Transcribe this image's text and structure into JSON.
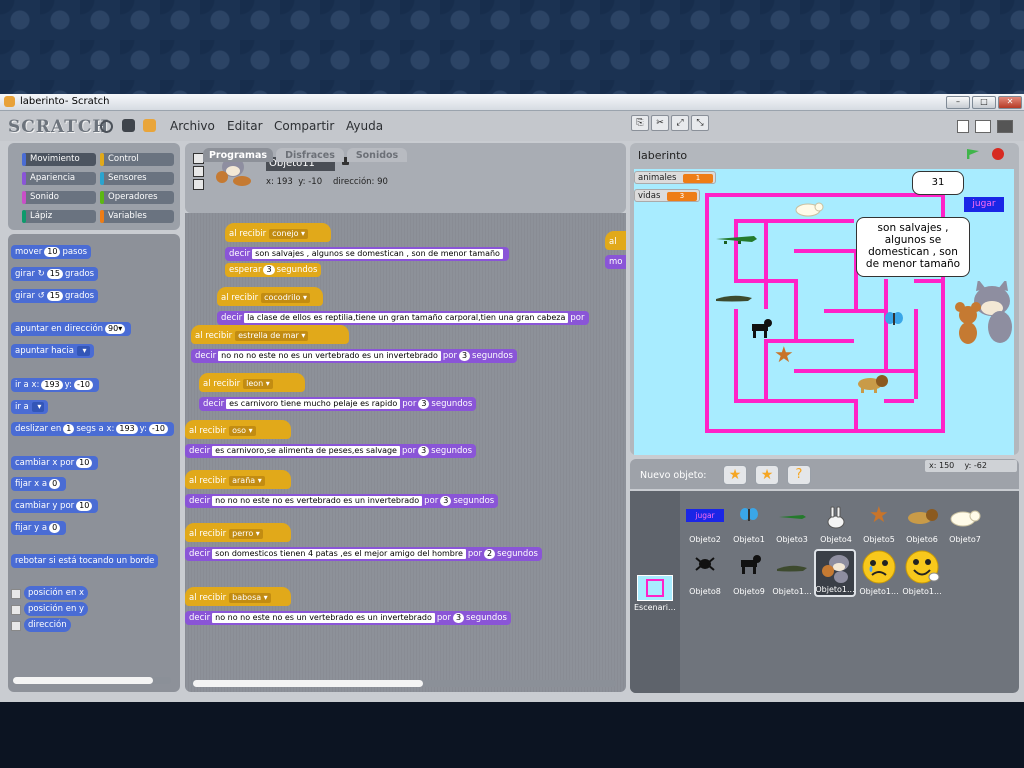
{
  "window": {
    "title": "laberinto- Scratch",
    "controls": {
      "minimize": "–",
      "maximize": "□",
      "close": "✕"
    }
  },
  "menubar": {
    "logo": "SCRATCH",
    "icons": [
      "globe-icon",
      "save-icon",
      "share-icon"
    ],
    "menus": [
      "Archivo",
      "Editar",
      "Compartir",
      "Ayuda"
    ],
    "edit_modes": [
      "stamp-icon",
      "scissors-icon",
      "grow-icon",
      "shrink-icon"
    ]
  },
  "categories": [
    {
      "label": "Movimiento",
      "color": "#4a6cd4",
      "selected": true
    },
    {
      "label": "Control",
      "color": "#e1a91a",
      "selected": false
    },
    {
      "label": "Apariencia",
      "color": "#8a55d7",
      "selected": false
    },
    {
      "label": "Sensores",
      "color": "#2aa4cf",
      "selected": false
    },
    {
      "label": "Sonido",
      "color": "#c94fc7",
      "selected": false
    },
    {
      "label": "Operadores",
      "color": "#5cb712",
      "selected": false
    },
    {
      "label": "Lápiz",
      "color": "#0e9a6c",
      "selected": false
    },
    {
      "label": "Variables",
      "color": "#ee7d16",
      "selected": false
    }
  ],
  "palette": {
    "mover": {
      "pre": "mover",
      "val": "10",
      "post": "pasos"
    },
    "girar_r": {
      "pre": "girar",
      "icon": "↻",
      "val": "15",
      "post": "grados"
    },
    "girar_l": {
      "pre": "girar",
      "icon": "↺",
      "val": "15",
      "post": "grados"
    },
    "apuntar_dir": {
      "pre": "apuntar en dirección",
      "val": "90▾"
    },
    "apuntar_hacia": {
      "pre": "apuntar hacia"
    },
    "ir_a_xy": {
      "pre": "ir a x:",
      "x": "193",
      "mid": "y:",
      "y": "-10"
    },
    "ir_a": {
      "pre": "ir a"
    },
    "deslizar": {
      "pre": "deslizar en",
      "val": "1",
      "mid": "segs a x:",
      "x": "193",
      "mid2": "y:",
      "y": "-10"
    },
    "cambiar_x": {
      "pre": "cambiar x por",
      "val": "10"
    },
    "fijar_x": {
      "pre": "fijar x a",
      "val": "0"
    },
    "cambiar_y": {
      "pre": "cambiar y por",
      "val": "10"
    },
    "fijar_y": {
      "pre": "fijar y a",
      "val": "0"
    },
    "rebotar": {
      "label": "rebotar si está tocando un borde"
    },
    "pos_x": {
      "label": "posición en x"
    },
    "pos_y": {
      "label": "posición en y"
    },
    "direccion": {
      "label": "dirección"
    }
  },
  "sprite_info": {
    "name": "Objeto11",
    "x_label": "x:",
    "x": "193",
    "y_label": "y:",
    "y": "-10",
    "dir_label": "dirección:",
    "dir": "90"
  },
  "tabs": [
    "Programas",
    "Disfraces",
    "Sonidos"
  ],
  "scripts": [
    {
      "hat": "al recibir",
      "msg": "conejo",
      "say": "decir",
      "text": "son salvajes , algunos se domestican , son de menor tamaño",
      "extra": {
        "pre": "esperar",
        "val": "3",
        "post": "segundos"
      }
    },
    {
      "hat": "al recibir",
      "msg": "cocodrilo",
      "say": "decir",
      "text": "la clase de ellos es reptilia,tiene un gran tamaño carporal,tien una gran cabeza",
      "por": "por"
    },
    {
      "hat": "al recibir",
      "msg": "estrella de mar",
      "say": "decir",
      "text": "no no no este no es un vertebrado es un invertebrado",
      "por": "por",
      "val": "3",
      "post": "segundos"
    },
    {
      "hat": "al recibir",
      "msg": "leon",
      "say": "decir",
      "text": "es carnivoro tiene mucho pelaje es rapido",
      "por": "por",
      "val": "3",
      "post": "segundos"
    },
    {
      "hat": "al recibir",
      "msg": "oso",
      "say": "decir",
      "text": "es carnivoro,se alimenta de peses,es salvage",
      "por": "por",
      "val": "3",
      "post": "segundos"
    },
    {
      "hat": "al recibir",
      "msg": "araña",
      "say": "decir",
      "text": "no no no este no es vertebrado es un invertebrado",
      "por": "por",
      "val": "3",
      "post": "segundos"
    },
    {
      "hat": "al recibir",
      "msg": "perro",
      "say": "decir",
      "text": "son domesticos tienen 4 patas ,es el  mejor amigo del hombre",
      "por": "por",
      "val": "2",
      "post": "segundos"
    },
    {
      "hat": "al recibir",
      "msg": "babosa",
      "say": "decir",
      "text": "no no no este no es un vertebrado es un invertebrado",
      "por": "por",
      "val": "3",
      "post": "segundos"
    }
  ],
  "offscreen_script": {
    "hat": "al",
    "say": "mo"
  },
  "stage": {
    "title": "laberinto",
    "vars": [
      {
        "name": "animales",
        "value": "1"
      },
      {
        "name": "vidas",
        "value": "3"
      }
    ],
    "bubble_score": "31",
    "bubble_text": "son salvajes , algunos se domestican , son de menor tamaño",
    "jugar_label": "jugar",
    "coords": {
      "x_label": "x:",
      "x": "150",
      "y_label": "y:",
      "y": "-62"
    }
  },
  "new_sprite": {
    "label": "Nuevo objeto:"
  },
  "sprites": [
    {
      "label": "Objeto2",
      "icon": "jugar-button-sprite"
    },
    {
      "label": "Objeto1",
      "icon": "butterfly-icon"
    },
    {
      "label": "Objeto3",
      "icon": "crocodile-icon"
    },
    {
      "label": "Objeto4",
      "icon": "rabbit-icon"
    },
    {
      "label": "Objeto5",
      "icon": "starfish-icon"
    },
    {
      "label": "Objeto6",
      "icon": "lion-icon"
    },
    {
      "label": "Objeto7",
      "icon": "bear-icon"
    },
    {
      "label": "Objeto8",
      "icon": "spider-icon"
    },
    {
      "label": "Objeto9",
      "icon": "dog-icon"
    },
    {
      "label": "Objeto1...",
      "icon": "slug-icon"
    },
    {
      "label": "Objeto1...",
      "icon": "tom-jerry-icon",
      "selected": true
    },
    {
      "label": "Objeto1...",
      "icon": "sad-face-icon"
    },
    {
      "label": "Objeto1...",
      "icon": "happy-face-icon"
    }
  ],
  "stage_thumb": {
    "label": "Escenari..."
  },
  "colors": {
    "motion": "#4a6cd4",
    "looks": "#8a55d7",
    "control": "#e1a91a",
    "maze": "#ff22c8",
    "stage_bg": "#a8ecff",
    "var": "#ee7d16"
  }
}
